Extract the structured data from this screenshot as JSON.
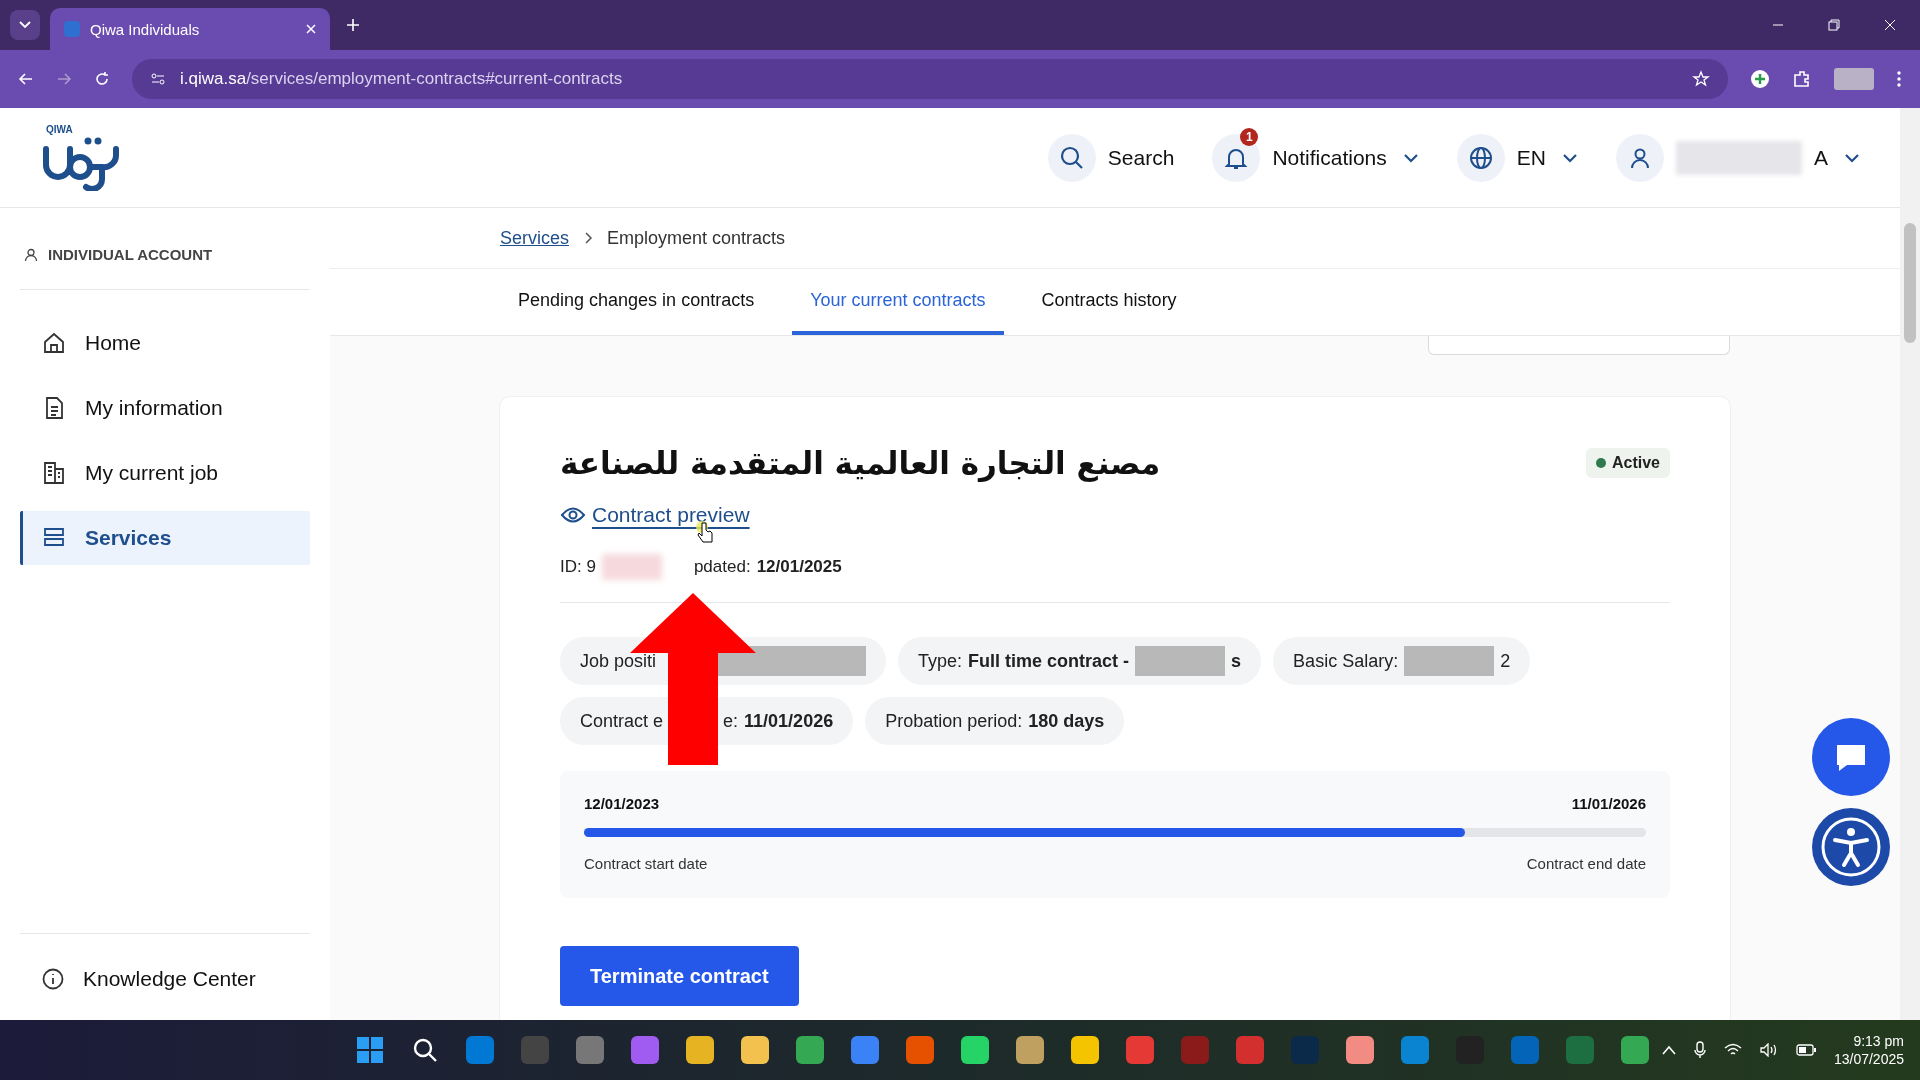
{
  "browser": {
    "tab_title": "Qiwa Individuals",
    "url_host": "i.qiwa.sa",
    "url_path": "/services/employment-contracts#current-contracts"
  },
  "header": {
    "logo_text": "QIWA",
    "search": "Search",
    "notifications": {
      "label": "Notifications",
      "badge": "1"
    },
    "language": "EN",
    "user_suffix": "A"
  },
  "sidebar": {
    "account": "INDIVIDUAL ACCOUNT",
    "items": [
      {
        "label": "Home",
        "selected": false
      },
      {
        "label": "My information",
        "selected": false
      },
      {
        "label": "My current job",
        "selected": false
      },
      {
        "label": "Services",
        "selected": true
      }
    ],
    "footer": {
      "label": "Knowledge Center"
    }
  },
  "breadcrumb": [
    "Services",
    "Employment contracts"
  ],
  "tabs": [
    {
      "label": "Pending changes in contracts",
      "selected": false
    },
    {
      "label": "Your current contracts",
      "selected": true
    },
    {
      "label": "Contracts history",
      "selected": false
    }
  ],
  "contract": {
    "title": "مصنع التجارة العالمية المتقدمة للصناعة",
    "status": "Active",
    "preview_link": "Contract preview",
    "meta": [
      {
        "kind": "text",
        "text": "ID: 9"
      },
      {
        "kind": "redacted"
      },
      {
        "kind": "hidden"
      },
      {
        "kind": "text",
        "text": "pdated:"
      },
      {
        "kind": "bold",
        "text": "12/01/2025"
      }
    ],
    "chips": [
      [
        {
          "kind": "text",
          "text": "Job positi"
        },
        {
          "kind": "hidden"
        },
        {
          "kind": "redacted"
        }
      ],
      [
        {
          "kind": "text",
          "text": "Type:"
        },
        {
          "kind": "bold",
          "text": "Full time contract -"
        },
        {
          "kind": "redacted"
        },
        {
          "kind": "bold",
          "text": "s"
        }
      ],
      [
        {
          "kind": "text",
          "text": "Basic Salary:"
        },
        {
          "kind": "redacted"
        },
        {
          "kind": "text",
          "text": "2"
        }
      ],
      [
        {
          "kind": "text",
          "text": "Contract e"
        },
        {
          "kind": "hidden"
        },
        {
          "kind": "text",
          "text": "e:"
        },
        {
          "kind": "bold",
          "text": "11/01/2026"
        }
      ],
      [
        {
          "kind": "text",
          "text": "Probation period:"
        },
        {
          "kind": "bold",
          "text": "180 days"
        }
      ]
    ],
    "timeline": {
      "start": "12/01/2023",
      "end": "11/01/2026",
      "start_label": "Contract start date",
      "end_label": "Contract end date",
      "level": 0.83
    },
    "terminate": "Terminate contract"
  },
  "taskbar": {
    "time": "9:13 pm",
    "date": "13/07/2025"
  }
}
